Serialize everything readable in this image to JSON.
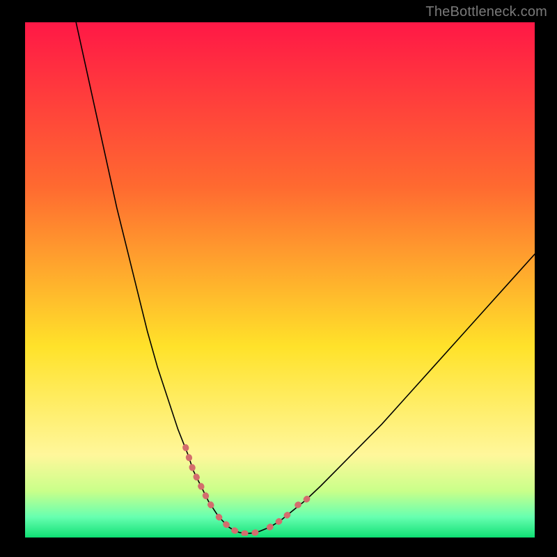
{
  "watermark": "TheBottleneck.com",
  "colors": {
    "frame_bg": "#000000",
    "watermark": "#7a7a7a",
    "curve": "#000000",
    "segment": "#d36d6d",
    "bottom_line": "#11e075",
    "grad_top": "#ff1846",
    "grad_upper": "#ff6a30",
    "grad_mid": "#ffe22a",
    "grad_band1": "#fff79b",
    "grad_band2": "#c9ff8a",
    "grad_band3": "#67ffb0",
    "grad_bottom": "#11e075"
  },
  "chart_data": {
    "type": "line",
    "title": "",
    "xlabel": "",
    "ylabel": "",
    "xlim": [
      0,
      100
    ],
    "ylim": [
      0,
      100
    ],
    "x": [
      10,
      12,
      14,
      16,
      18,
      20,
      22,
      24,
      26,
      28,
      30,
      32,
      33,
      34,
      35,
      36,
      37,
      38,
      39,
      40,
      41,
      42,
      43,
      44,
      45,
      46,
      48,
      50,
      52,
      55,
      58,
      62,
      66,
      70,
      75,
      80,
      85,
      90,
      95,
      100
    ],
    "values": [
      100,
      91,
      82,
      73,
      64,
      56,
      48,
      40,
      33,
      27,
      21,
      16,
      13,
      11,
      9,
      7,
      5.5,
      4,
      3,
      2,
      1.4,
      1,
      0.8,
      0.8,
      0.9,
      1.2,
      2,
      3.2,
      4.8,
      7.2,
      10,
      14,
      18,
      22,
      27.5,
      33,
      38.5,
      44,
      49.5,
      55
    ],
    "highlight_segments": [
      {
        "x": [
          31.5,
          33,
          34,
          35,
          36,
          37
        ],
        "y": [
          17.5,
          13,
          11,
          9,
          7,
          5.5
        ]
      },
      {
        "x": [
          38,
          39,
          40,
          41,
          42,
          43,
          44,
          45,
          46,
          47
        ],
        "y": [
          4,
          3,
          2,
          1.4,
          1,
          0.8,
          0.8,
          0.9,
          1.2,
          1.6
        ]
      },
      {
        "x": [
          48,
          49.5,
          51,
          52.5
        ],
        "y": [
          2,
          2.9,
          4,
          5.2
        ]
      },
      {
        "x": [
          53.5,
          55,
          56.5
        ],
        "y": [
          6.3,
          7.2,
          8.6
        ]
      }
    ],
    "annotations": []
  }
}
